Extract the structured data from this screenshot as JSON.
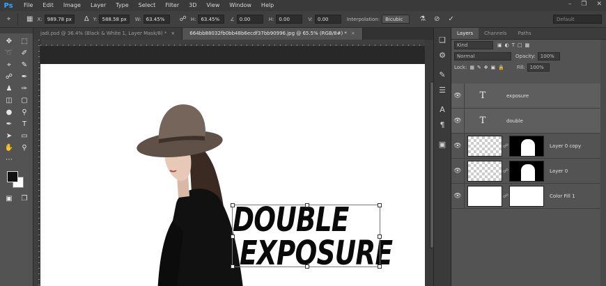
{
  "menubar": {
    "logo": "Ps",
    "items": [
      "File",
      "Edit",
      "Image",
      "Layer",
      "Type",
      "Select",
      "Filter",
      "3D",
      "View",
      "Window",
      "Help"
    ]
  },
  "options": {
    "x_label": "X:",
    "x_value": "989.78 px",
    "y_label": "Y:",
    "y_value": "588.58 px",
    "w_label": "W:",
    "w_value": "63.45%",
    "h_label": "H:",
    "h_value": "63.45%",
    "angle_value": "0.00",
    "hskew_label": "H:",
    "hskew_value": "0.00",
    "vskew_label": "V:",
    "vskew_value": "0.00",
    "interp_label": "Interpolation:",
    "interp_value": "Bicubic",
    "workspace": "Default"
  },
  "tabs": [
    {
      "label": "jadi.psd @ 36.4% (Black & White 1, Layer Mask/8) *",
      "close": "×"
    },
    {
      "label": "664bb88032fb0bb48b6ecdf37bb90996.jpg @ 65.5% (RGB/8#) *",
      "close": "×"
    }
  ],
  "canvas": {
    "line1": "DOUBLE",
    "line2": "EXPOSURE"
  },
  "panel": {
    "tabs": [
      "Layers",
      "Channels",
      "Paths"
    ],
    "kind_placeholder": "Kind",
    "blend_mode": "Normal",
    "opacity_label": "Opacity:",
    "opacity_value": "100%",
    "lock_label": "Lock:",
    "fill_label": "Fill:",
    "fill_value": "100%"
  },
  "layers": [
    {
      "name": "exposure",
      "kind": "text",
      "glyph": "T"
    },
    {
      "name": "double",
      "kind": "text",
      "glyph": "T"
    },
    {
      "name": "Layer 0 copy",
      "kind": "image"
    },
    {
      "name": "Layer 0",
      "kind": "image"
    },
    {
      "name": "Color Fill 1",
      "kind": "fill"
    }
  ],
  "colors": {
    "accent": "#31a8ff",
    "foreground": "#111111",
    "background": "#ffffff"
  }
}
